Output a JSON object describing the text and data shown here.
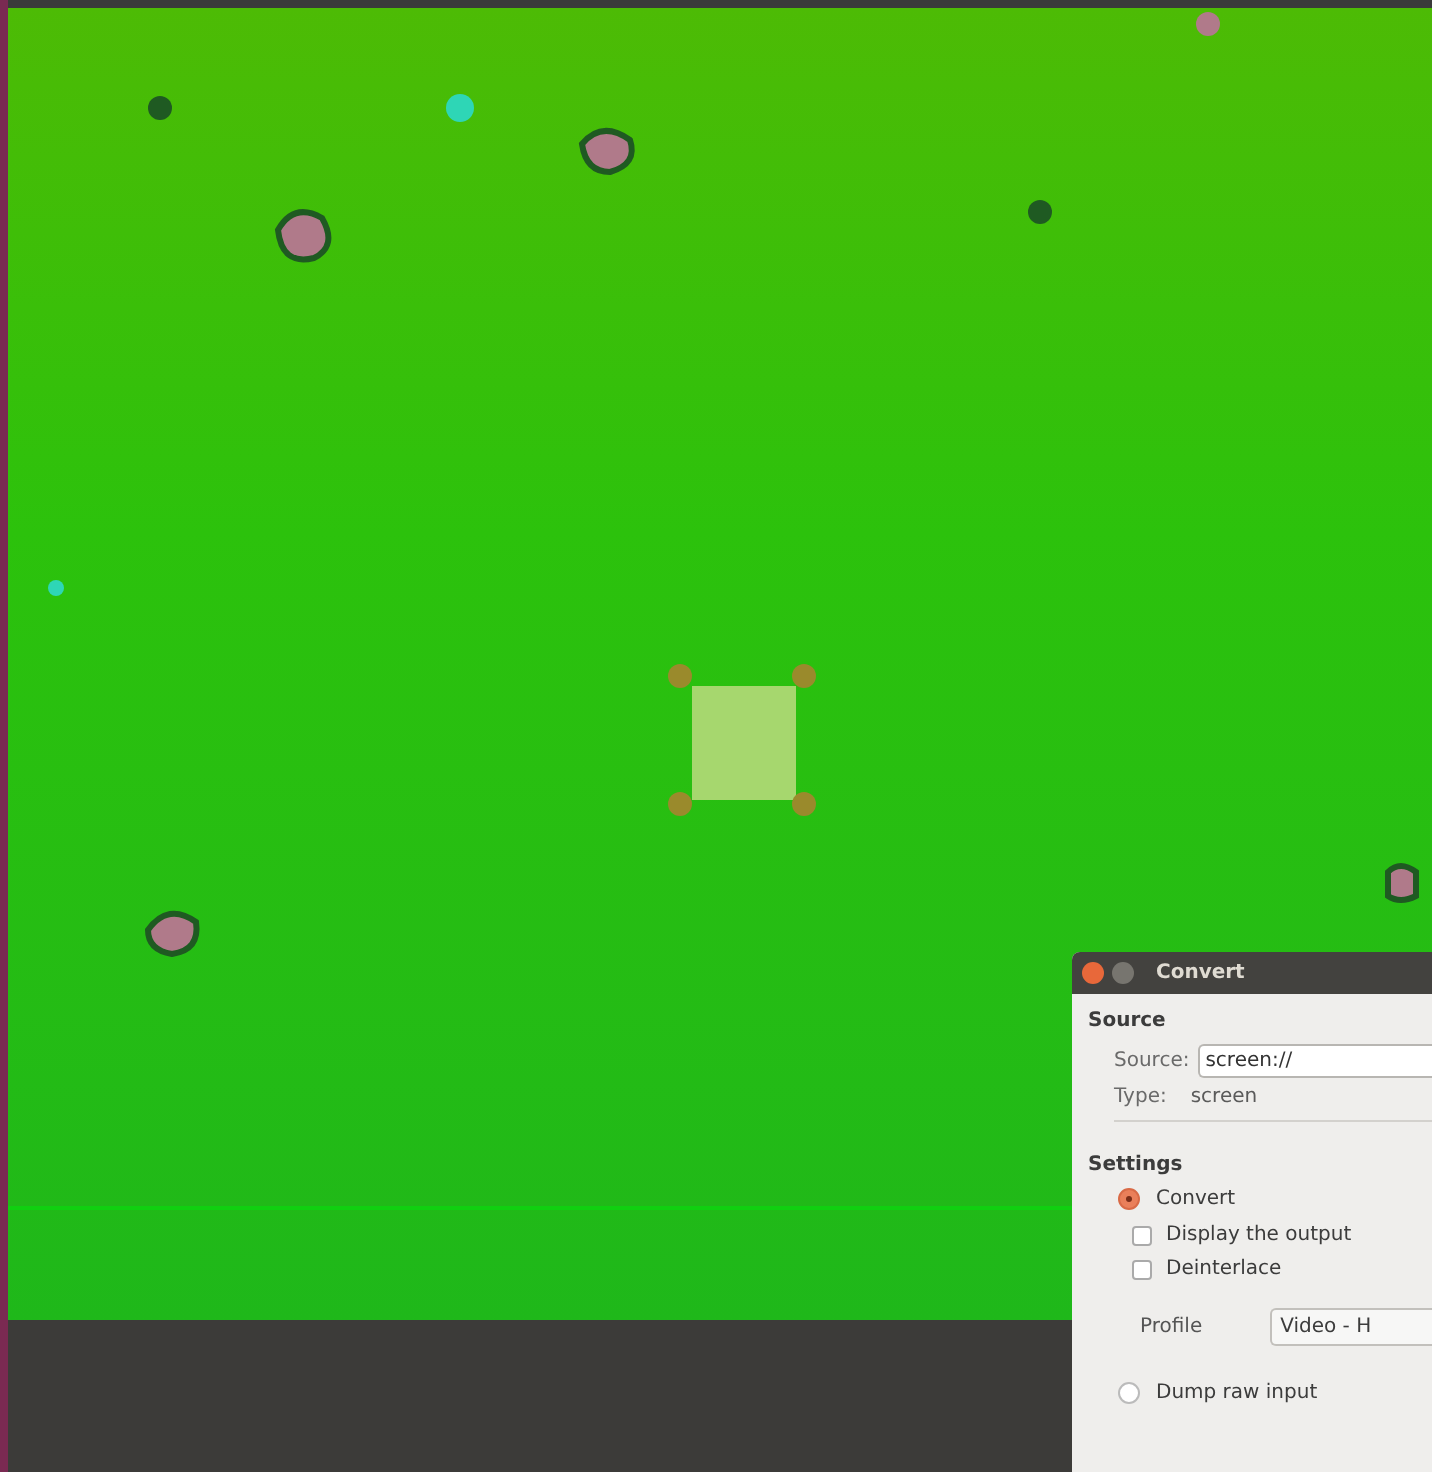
{
  "dialog": {
    "title": "Convert",
    "source_heading": "Source",
    "source_label": "Source:",
    "source_value": "screen://",
    "type_label": "Type:",
    "type_value": "screen",
    "settings_heading": "Settings",
    "options": [
      {
        "kind": "radio",
        "label": "Convert",
        "selected": true
      },
      {
        "kind": "checkbox",
        "label": "Display the output",
        "checked": false
      },
      {
        "kind": "checkbox",
        "label": "Deinterlace",
        "checked": false
      },
      {
        "kind": "profile",
        "label": "Profile",
        "value": "Video - H"
      },
      {
        "kind": "radio",
        "label": "Dump raw input",
        "selected": false
      }
    ]
  }
}
